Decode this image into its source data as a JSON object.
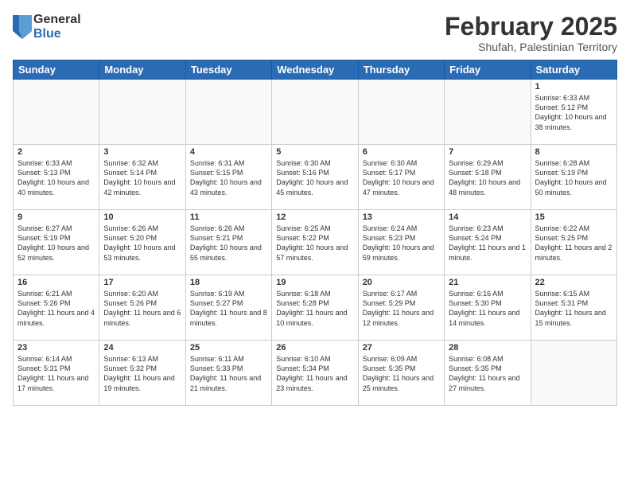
{
  "logo": {
    "general": "General",
    "blue": "Blue"
  },
  "header": {
    "month": "February 2025",
    "location": "Shufah, Palestinian Territory"
  },
  "weekdays": [
    "Sunday",
    "Monday",
    "Tuesday",
    "Wednesday",
    "Thursday",
    "Friday",
    "Saturday"
  ],
  "weeks": [
    [
      {
        "day": "",
        "info": ""
      },
      {
        "day": "",
        "info": ""
      },
      {
        "day": "",
        "info": ""
      },
      {
        "day": "",
        "info": ""
      },
      {
        "day": "",
        "info": ""
      },
      {
        "day": "",
        "info": ""
      },
      {
        "day": "1",
        "info": "Sunrise: 6:33 AM\nSunset: 5:12 PM\nDaylight: 10 hours and 38 minutes."
      }
    ],
    [
      {
        "day": "2",
        "info": "Sunrise: 6:33 AM\nSunset: 5:13 PM\nDaylight: 10 hours and 40 minutes."
      },
      {
        "day": "3",
        "info": "Sunrise: 6:32 AM\nSunset: 5:14 PM\nDaylight: 10 hours and 42 minutes."
      },
      {
        "day": "4",
        "info": "Sunrise: 6:31 AM\nSunset: 5:15 PM\nDaylight: 10 hours and 43 minutes."
      },
      {
        "day": "5",
        "info": "Sunrise: 6:30 AM\nSunset: 5:16 PM\nDaylight: 10 hours and 45 minutes."
      },
      {
        "day": "6",
        "info": "Sunrise: 6:30 AM\nSunset: 5:17 PM\nDaylight: 10 hours and 47 minutes."
      },
      {
        "day": "7",
        "info": "Sunrise: 6:29 AM\nSunset: 5:18 PM\nDaylight: 10 hours and 48 minutes."
      },
      {
        "day": "8",
        "info": "Sunrise: 6:28 AM\nSunset: 5:19 PM\nDaylight: 10 hours and 50 minutes."
      }
    ],
    [
      {
        "day": "9",
        "info": "Sunrise: 6:27 AM\nSunset: 5:19 PM\nDaylight: 10 hours and 52 minutes."
      },
      {
        "day": "10",
        "info": "Sunrise: 6:26 AM\nSunset: 5:20 PM\nDaylight: 10 hours and 53 minutes."
      },
      {
        "day": "11",
        "info": "Sunrise: 6:26 AM\nSunset: 5:21 PM\nDaylight: 10 hours and 55 minutes."
      },
      {
        "day": "12",
        "info": "Sunrise: 6:25 AM\nSunset: 5:22 PM\nDaylight: 10 hours and 57 minutes."
      },
      {
        "day": "13",
        "info": "Sunrise: 6:24 AM\nSunset: 5:23 PM\nDaylight: 10 hours and 59 minutes."
      },
      {
        "day": "14",
        "info": "Sunrise: 6:23 AM\nSunset: 5:24 PM\nDaylight: 11 hours and 1 minute."
      },
      {
        "day": "15",
        "info": "Sunrise: 6:22 AM\nSunset: 5:25 PM\nDaylight: 11 hours and 2 minutes."
      }
    ],
    [
      {
        "day": "16",
        "info": "Sunrise: 6:21 AM\nSunset: 5:26 PM\nDaylight: 11 hours and 4 minutes."
      },
      {
        "day": "17",
        "info": "Sunrise: 6:20 AM\nSunset: 5:26 PM\nDaylight: 11 hours and 6 minutes."
      },
      {
        "day": "18",
        "info": "Sunrise: 6:19 AM\nSunset: 5:27 PM\nDaylight: 11 hours and 8 minutes."
      },
      {
        "day": "19",
        "info": "Sunrise: 6:18 AM\nSunset: 5:28 PM\nDaylight: 11 hours and 10 minutes."
      },
      {
        "day": "20",
        "info": "Sunrise: 6:17 AM\nSunset: 5:29 PM\nDaylight: 11 hours and 12 minutes."
      },
      {
        "day": "21",
        "info": "Sunrise: 6:16 AM\nSunset: 5:30 PM\nDaylight: 11 hours and 14 minutes."
      },
      {
        "day": "22",
        "info": "Sunrise: 6:15 AM\nSunset: 5:31 PM\nDaylight: 11 hours and 15 minutes."
      }
    ],
    [
      {
        "day": "23",
        "info": "Sunrise: 6:14 AM\nSunset: 5:31 PM\nDaylight: 11 hours and 17 minutes."
      },
      {
        "day": "24",
        "info": "Sunrise: 6:13 AM\nSunset: 5:32 PM\nDaylight: 11 hours and 19 minutes."
      },
      {
        "day": "25",
        "info": "Sunrise: 6:11 AM\nSunset: 5:33 PM\nDaylight: 11 hours and 21 minutes."
      },
      {
        "day": "26",
        "info": "Sunrise: 6:10 AM\nSunset: 5:34 PM\nDaylight: 11 hours and 23 minutes."
      },
      {
        "day": "27",
        "info": "Sunrise: 6:09 AM\nSunset: 5:35 PM\nDaylight: 11 hours and 25 minutes."
      },
      {
        "day": "28",
        "info": "Sunrise: 6:08 AM\nSunset: 5:35 PM\nDaylight: 11 hours and 27 minutes."
      },
      {
        "day": "",
        "info": ""
      }
    ]
  ]
}
